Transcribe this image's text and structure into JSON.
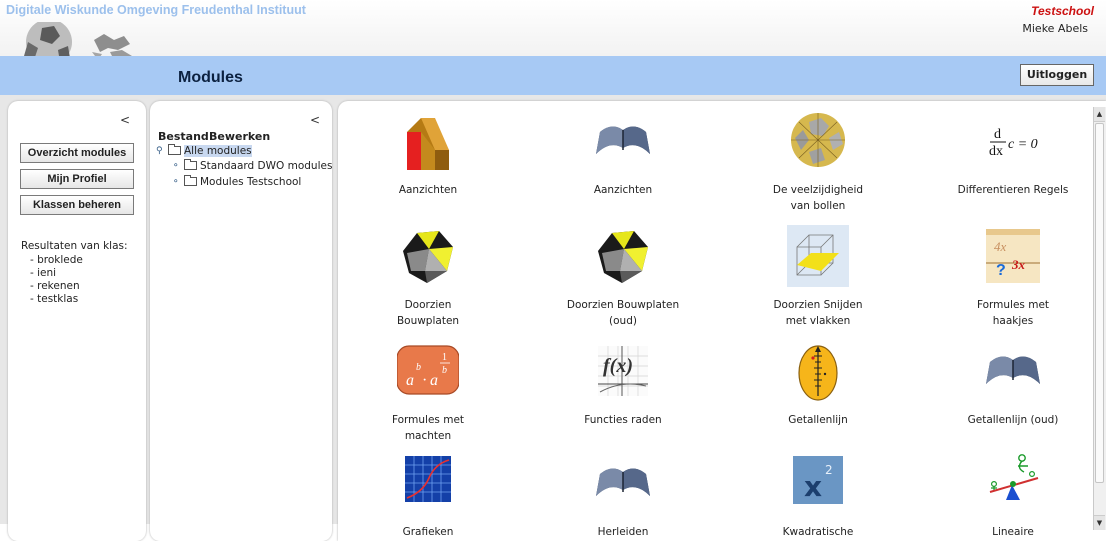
{
  "header": {
    "app_title": "Digitale Wiskunde Omgeving  Freudenthal Instituut",
    "school": "Testschool",
    "user": "Mieke Abels",
    "page_title": "Modules",
    "logout_label": "Uitloggen"
  },
  "left_panel": {
    "collapse": "<",
    "buttons": [
      "Overzicht modules",
      "Mijn Profiel",
      "Klassen beheren"
    ],
    "results_title": "Resultaten van klas:",
    "classes": [
      "-  broklede",
      "-  ieni",
      "-  rekenen",
      "-  testklas"
    ]
  },
  "tree_panel": {
    "collapse": "<",
    "menu": [
      "Bestand",
      "Bewerken"
    ],
    "root": "Alle modules",
    "children": [
      "Standaard DWO modules",
      "Modules Testschool"
    ]
  },
  "modules": [
    {
      "label": "Aanzichten",
      "icon": "red-block-icon"
    },
    {
      "label": "Aanzichten",
      "icon": "book-icon"
    },
    {
      "label": "De veelzijdigheid van bollen",
      "icon": "polyhedron-ball-icon"
    },
    {
      "label": "Differentieren Regels",
      "icon": "derivative-formula-icon"
    },
    {
      "label": "Doorzien Bouwplaten",
      "icon": "net-solid-icon"
    },
    {
      "label": "Doorzien Bouwplaten (oud)",
      "icon": "net-solid-icon"
    },
    {
      "label": "Doorzien Snijden met vlakken",
      "icon": "cube-plane-icon"
    },
    {
      "label": "Formules met haakjes",
      "icon": "brackets-formula-icon"
    },
    {
      "label": "Formules met machten",
      "icon": "powers-formula-icon"
    },
    {
      "label": "Functies raden",
      "icon": "function-graph-icon"
    },
    {
      "label": "Getallenlijn",
      "icon": "numberline-icon"
    },
    {
      "label": "Getallenlijn (oud)",
      "icon": "book-icon"
    },
    {
      "label": "Grafieken",
      "icon": "graph-grid-icon"
    },
    {
      "label": "Herleiden",
      "icon": "book-icon"
    },
    {
      "label": "Kwadratische",
      "icon": "x-squared-icon"
    },
    {
      "label": "Lineaire",
      "icon": "seesaw-icon"
    }
  ],
  "derivative_text": {
    "d": "d",
    "dx": "dx",
    "rest": "c = 0"
  },
  "brackets_text": {
    "a": "4x",
    "b": "3x",
    "q": "?"
  },
  "powers_text": {
    "a": "a",
    "b": "b",
    "dot": "·",
    "one": "1"
  },
  "function_text": "f(x)",
  "kwadr_text": {
    "x": "x",
    "two": "2"
  }
}
